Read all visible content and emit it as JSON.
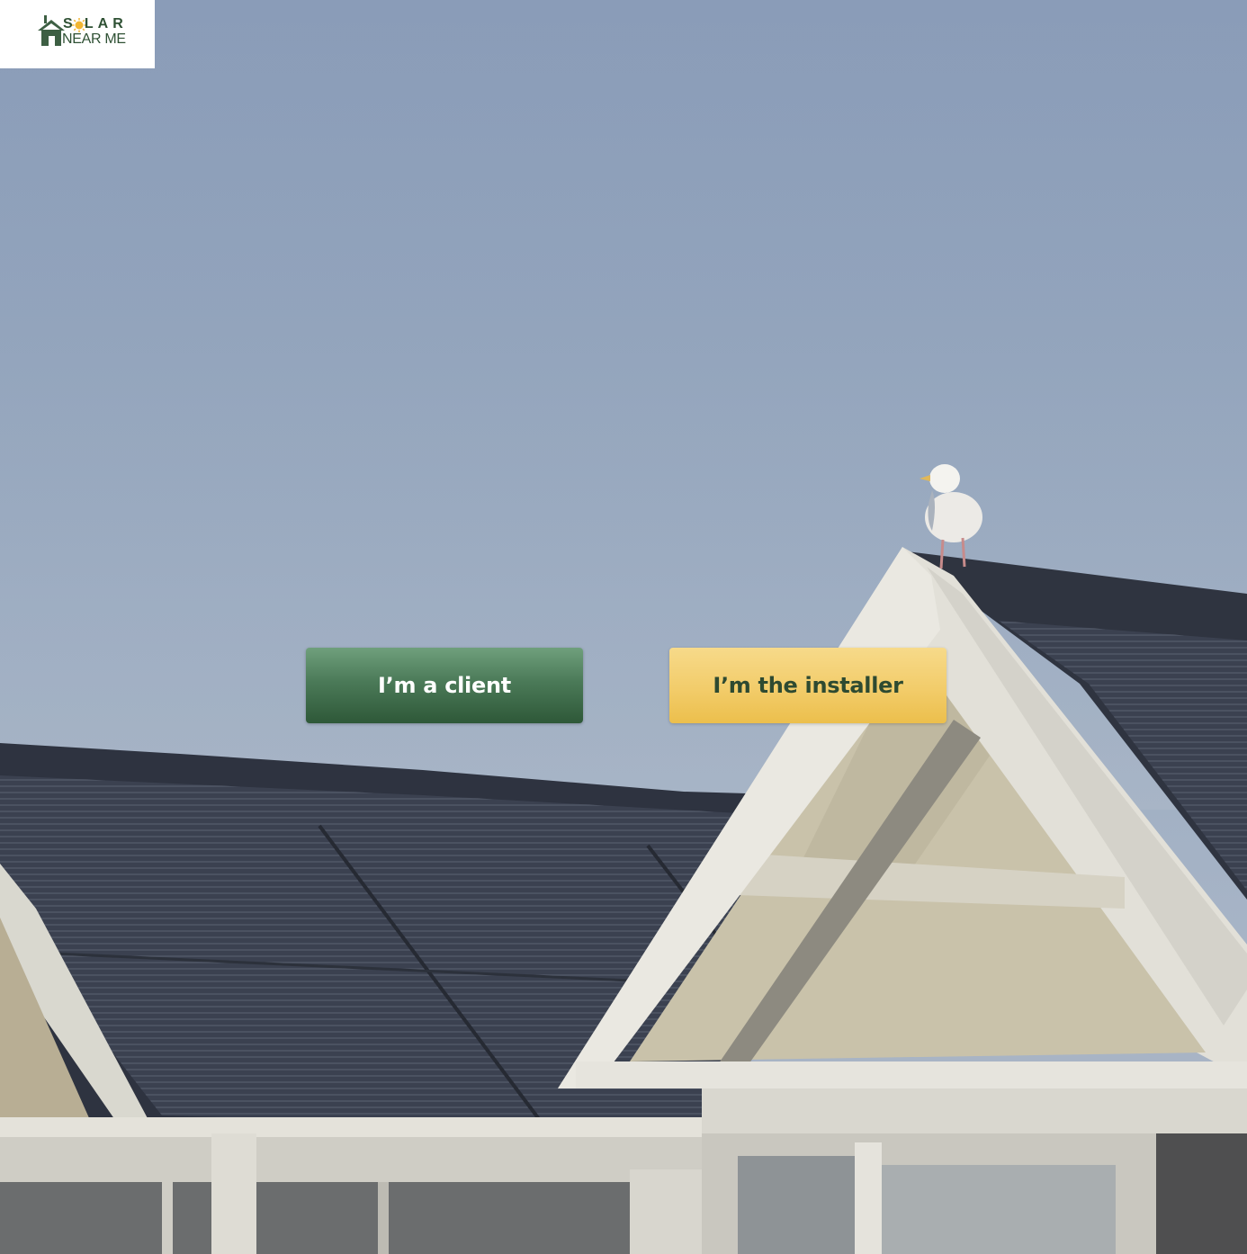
{
  "logo": {
    "line1": "S LAR",
    "line2": "NEAR ME",
    "colors": {
      "green": "#2f5134",
      "sun": "#f2b632"
    }
  },
  "hero": {
    "image": "rooftop-solar-panels-with-seagull-photo"
  },
  "actions": {
    "client_label": "I’m a client",
    "installer_label": "I’m the installer"
  },
  "colors": {
    "client_button": "#3f6e4b",
    "installer_button": "#f2c95f",
    "installer_text": "#2e4a31"
  }
}
